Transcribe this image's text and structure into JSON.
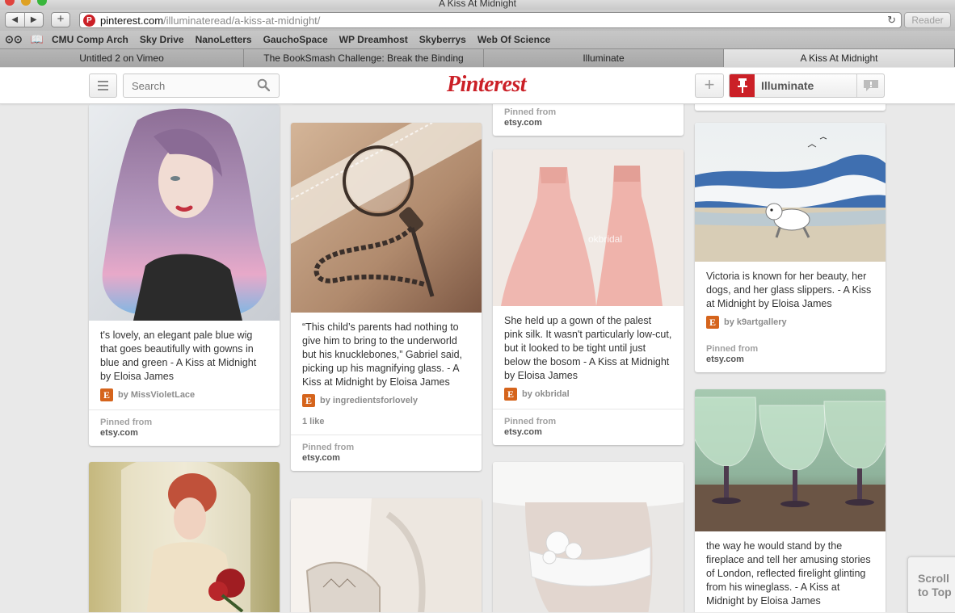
{
  "window": {
    "title": "A Kiss At Midnight"
  },
  "toolbar": {
    "back_icon": "back-arrow-icon",
    "forward_icon": "forward-arrow-icon",
    "url_host": "pinterest.com",
    "url_path": "/illuminateread/a-kiss-at-midnight/",
    "reader_label": "Reader"
  },
  "bookmarks": [
    "CMU Comp Arch",
    "Sky Drive",
    "NanoLetters",
    "GauchoSpace",
    "WP Dreamhost",
    "Skyberrys",
    "Web Of Science"
  ],
  "tabs": [
    {
      "label": "Untitled 2 on Vimeo",
      "active": false
    },
    {
      "label": "The BookSmash Challenge: Break the Binding",
      "active": false
    },
    {
      "label": "Illuminate",
      "active": false
    },
    {
      "label": "A Kiss At Midnight",
      "active": true
    }
  ],
  "header": {
    "search_placeholder": "Search",
    "logo": "Pinterest",
    "user_name": "Illuminate"
  },
  "pins": {
    "col1_top": {
      "description": "t's lovely, an elegant pale blue wig that goes beautifully with gowns in blue and green - A Kiss at Midnight by Eloisa James",
      "by": "by MissVioletLace",
      "pinned_from_label": "Pinned from",
      "pinned_from": "etsy.com"
    },
    "col2_top": {
      "description": "“This child’s parents had nothing to give him to bring to the underworld but his knucklebones,” Gabriel said, picking up his magnifying glass. - A Kiss at Midnight by Eloisa James",
      "by": "by ingredientsforlovely",
      "likes": "1 like",
      "pinned_from_label": "Pinned from",
      "pinned_from": "etsy.com"
    },
    "col3_partial": {
      "pinned_from_label": "Pinned from",
      "pinned_from": "etsy.com"
    },
    "col3_dress": {
      "watermark": "okbridal",
      "description": "She held up a gown of the palest pink silk. It wasn't particularly low-cut, but it looked to be tight until just below the bosom - A Kiss at Midnight by Eloisa James",
      "by": "by okbridal",
      "pinned_from_label": "Pinned from",
      "pinned_from": "etsy.com"
    },
    "col4_dog": {
      "description": "Victoria is known for her beauty, her dogs, and her glass slippers. - A Kiss at Midnight by Eloisa James",
      "by": "by k9artgallery",
      "pinned_from_label": "Pinned from",
      "pinned_from": "etsy.com"
    },
    "col4_glass": {
      "description": "the way he would stand by the fireplace and tell her amusing stories of London, reflected firelight glinting from his wineglass. - A Kiss at Midnight by Eloisa James"
    }
  },
  "scroll_to_top": {
    "line1": "Scroll",
    "line2": "to Top"
  },
  "colors": {
    "pinterest_red": "#cb2027",
    "etsy_orange": "#d5641c",
    "page_bg": "#e9e9e9"
  }
}
